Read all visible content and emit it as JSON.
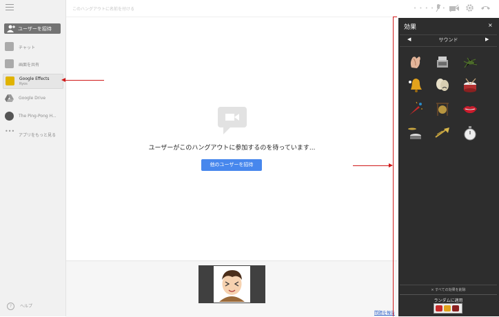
{
  "topbar": {
    "hangout_title_placeholder": "このハングアウトに名前を付ける"
  },
  "sidebar": {
    "invite_label": "ユーザーを招待",
    "items": [
      {
        "label": "チャット"
      },
      {
        "label": "画面を共有"
      },
      {
        "label": "Google Effects",
        "sub": "Ryos"
      },
      {
        "label": "Google Drive"
      },
      {
        "label": "The Ping-Pong H..."
      },
      {
        "label": "アプリをもっと見る"
      }
    ],
    "help_label": "ヘルプ"
  },
  "main": {
    "waiting_text": "ユーザーがこのハングアウトに参加するのを待っています...",
    "invite_others_label": "他のユーザーを招待",
    "report_link": "問題を報告"
  },
  "effects_panel": {
    "title": "効果",
    "close_glyph": "×",
    "category": "サウンド",
    "effects": [
      "applause",
      "cash-register",
      "crickets",
      "bell",
      "theater-masks",
      "drum",
      "party-horn",
      "gong",
      "kiss-lips",
      "drum-cymbal",
      "trombone",
      "stopwatch"
    ],
    "remove_all_label": "× すべての効果を削除",
    "random_label": "ランダムに適用"
  },
  "colors": {
    "accent": "#4787ed",
    "panel_bg": "#2d2d2d",
    "annotation": "#d01818"
  }
}
